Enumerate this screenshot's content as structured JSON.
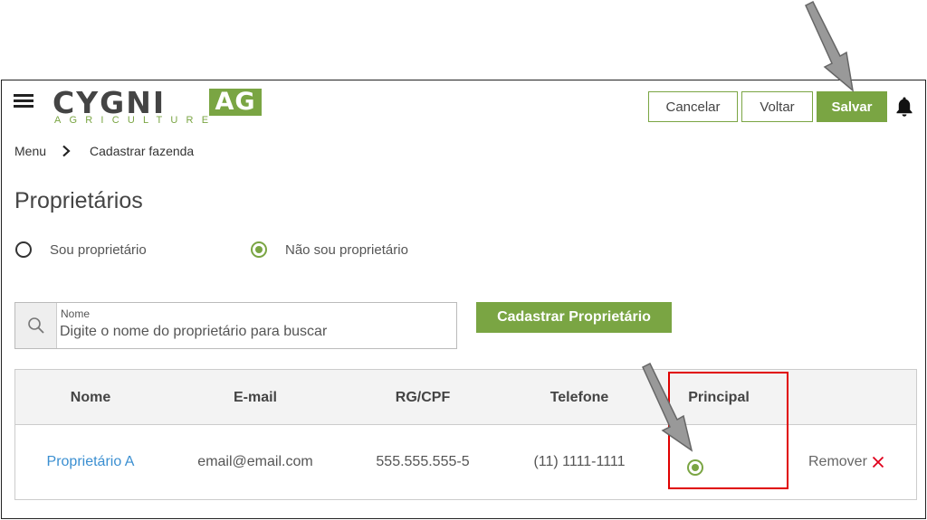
{
  "header": {
    "logo": {
      "main": "CYGNI",
      "badge": "AG",
      "subtitle": "AGRICULTURE"
    },
    "buttons": {
      "cancel": "Cancelar",
      "back": "Voltar",
      "save": "Salvar"
    }
  },
  "breadcrumb": {
    "root": "Menu",
    "current": "Cadastrar fazenda"
  },
  "section": {
    "title": "Proprietários"
  },
  "ownership": {
    "options": [
      "Sou proprietário",
      "Não sou proprietário"
    ],
    "selected": "Não sou proprietário"
  },
  "search": {
    "label": "Nome",
    "placeholder": "Digite o nome do proprietário para buscar",
    "value": ""
  },
  "register_button": "Cadastrar Proprietário",
  "table": {
    "columns": [
      "Nome",
      "E-mail",
      "RG/CPF",
      "Telefone",
      "Principal"
    ],
    "rows": [
      {
        "name": "Proprietário A",
        "email": "email@email.com",
        "document": "555.555.555-5",
        "phone": "(11) 1111-1111",
        "principal": true,
        "remove_label": "Remover"
      }
    ]
  },
  "colors": {
    "accent": "#7aa543",
    "link": "#3b8fd1",
    "highlight": "#e00000",
    "remove": "#e0001b"
  },
  "icons": [
    "menu-icon",
    "bell-icon",
    "chevron-right-icon",
    "search-icon",
    "close-icon",
    "annotation-arrow"
  ]
}
